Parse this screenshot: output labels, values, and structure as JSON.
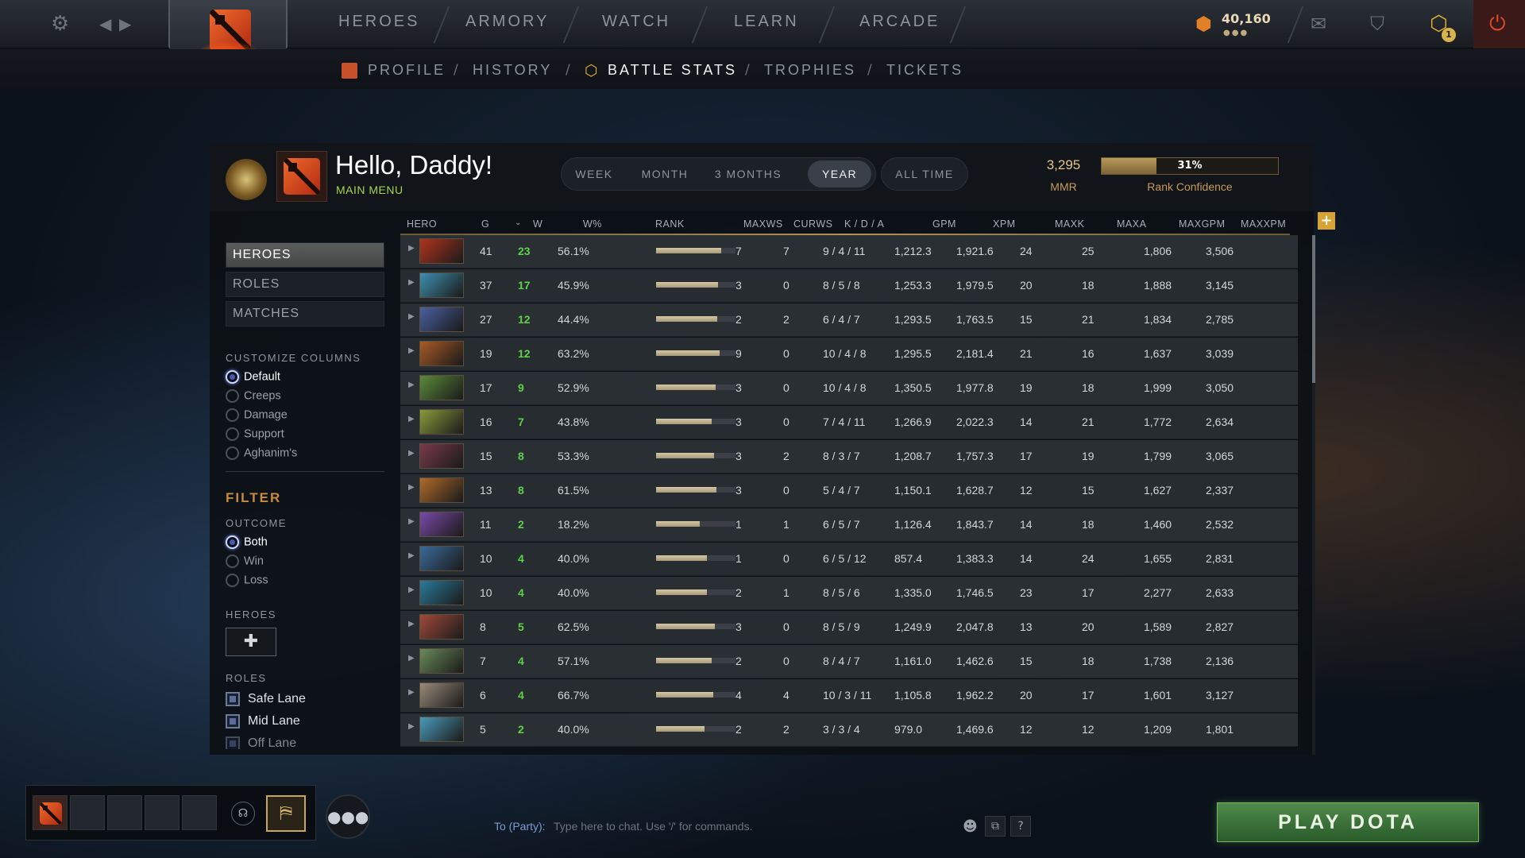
{
  "topnav": {
    "items": [
      "HEROES",
      "ARMORY",
      "WATCH",
      "LEARN",
      "ARCADE"
    ],
    "shards": "40,160",
    "notif_count": "1"
  },
  "subnav": {
    "items": [
      "PROFILE",
      "HISTORY",
      "BATTLE STATS",
      "TROPHIES",
      "TICKETS"
    ],
    "active": "BATTLE STATS"
  },
  "profile": {
    "greeting": "Hello, Daddy!",
    "main_menu": "MAIN MENU",
    "mmr": "3,295",
    "mmr_label": "MMR",
    "confidence_pct": "31%",
    "confidence_value": 0.31,
    "confidence_label": "Rank Confidence"
  },
  "ranges": [
    "WEEK",
    "MONTH",
    "3 MONTHS",
    "YEAR"
  ],
  "range_selected": "YEAR",
  "all_time": "ALL TIME",
  "columns": [
    "HERO",
    "G",
    "W",
    "W%",
    "RANK",
    "MAXWS",
    "CURWS",
    "K / D / A",
    "GPM",
    "XPM",
    "MAXK",
    "MAXA",
    "MAXGPM",
    "MAXXPM"
  ],
  "sidebar": {
    "tabs": [
      "HEROES",
      "ROLES",
      "MATCHES"
    ],
    "customize_title": "CUSTOMIZE COLUMNS",
    "customize_options": [
      "Default",
      "Creeps",
      "Damage",
      "Support",
      "Aghanim's"
    ],
    "filter_title": "FILTER",
    "outcome_title": "OUTCOME",
    "outcome_options": [
      "Both",
      "Win",
      "Loss"
    ],
    "heroes_title": "HEROES",
    "add_symbol": "✚",
    "roles_title": "ROLES",
    "roles": [
      "Safe Lane",
      "Mid Lane",
      "Off Lane"
    ]
  },
  "rows": [
    {
      "g": "41",
      "w": "23",
      "wp": "56.1%",
      "rank": 0.82,
      "maxws": "7",
      "curws": "7",
      "kda": "9 / 4 / 11",
      "gpm": "1,212.3",
      "xpm": "1,921.6",
      "maxk": "24",
      "maxa": "25",
      "maxgpm": "1,806",
      "maxxpm": "3,506",
      "color": "#b0341c"
    },
    {
      "g": "37",
      "w": "17",
      "wp": "45.9%",
      "rank": 0.78,
      "maxws": "3",
      "curws": "0",
      "kda": "8 / 5 / 8",
      "gpm": "1,253.3",
      "xpm": "1,979.5",
      "maxk": "20",
      "maxa": "18",
      "maxgpm": "1,888",
      "maxxpm": "3,145",
      "color": "#3f8fb0"
    },
    {
      "g": "27",
      "w": "12",
      "wp": "44.4%",
      "rank": 0.77,
      "maxws": "2",
      "curws": "2",
      "kda": "6 / 4 / 7",
      "gpm": "1,293.5",
      "xpm": "1,763.5",
      "maxk": "15",
      "maxa": "21",
      "maxgpm": "1,834",
      "maxxpm": "2,785",
      "color": "#4a5fa0"
    },
    {
      "g": "19",
      "w": "12",
      "wp": "63.2%",
      "rank": 0.8,
      "maxws": "9",
      "curws": "0",
      "kda": "10 / 4 / 8",
      "gpm": "1,295.5",
      "xpm": "2,181.4",
      "maxk": "21",
      "maxa": "16",
      "maxgpm": "1,637",
      "maxxpm": "3,039",
      "color": "#a85a26"
    },
    {
      "g": "17",
      "w": "9",
      "wp": "52.9%",
      "rank": 0.75,
      "maxws": "3",
      "curws": "0",
      "kda": "10 / 4 / 8",
      "gpm": "1,350.5",
      "xpm": "1,977.8",
      "maxk": "19",
      "maxa": "18",
      "maxgpm": "1,999",
      "maxxpm": "3,050",
      "color": "#5a8a3a"
    },
    {
      "g": "16",
      "w": "7",
      "wp": "43.8%",
      "rank": 0.7,
      "maxws": "3",
      "curws": "0",
      "kda": "7 / 4 / 11",
      "gpm": "1,266.9",
      "xpm": "2,022.3",
      "maxk": "14",
      "maxa": "21",
      "maxgpm": "1,772",
      "maxxpm": "2,634",
      "color": "#8a9a3a"
    },
    {
      "g": "15",
      "w": "8",
      "wp": "53.3%",
      "rank": 0.73,
      "maxws": "3",
      "curws": "2",
      "kda": "8 / 3 / 7",
      "gpm": "1,208.7",
      "xpm": "1,757.3",
      "maxk": "17",
      "maxa": "19",
      "maxgpm": "1,799",
      "maxxpm": "3,065",
      "color": "#7a3a4a"
    },
    {
      "g": "13",
      "w": "8",
      "wp": "61.5%",
      "rank": 0.76,
      "maxws": "3",
      "curws": "0",
      "kda": "5 / 4 / 7",
      "gpm": "1,150.1",
      "xpm": "1,628.7",
      "maxk": "12",
      "maxa": "15",
      "maxgpm": "1,627",
      "maxxpm": "2,337",
      "color": "#b06a2a"
    },
    {
      "g": "11",
      "w": "2",
      "wp": "18.2%",
      "rank": 0.55,
      "maxws": "1",
      "curws": "1",
      "kda": "6 / 5 / 7",
      "gpm": "1,126.4",
      "xpm": "1,843.7",
      "maxk": "14",
      "maxa": "18",
      "maxgpm": "1,460",
      "maxxpm": "2,532",
      "color": "#7a4aa8"
    },
    {
      "g": "10",
      "w": "4",
      "wp": "40.0%",
      "rank": 0.64,
      "maxws": "1",
      "curws": "0",
      "kda": "6 / 5 / 12",
      "gpm": "857.4",
      "xpm": "1,383.3",
      "maxk": "14",
      "maxa": "24",
      "maxgpm": "1,655",
      "maxxpm": "2,831",
      "color": "#3a6a9a"
    },
    {
      "g": "10",
      "w": "4",
      "wp": "40.0%",
      "rank": 0.64,
      "maxws": "2",
      "curws": "1",
      "kda": "8 / 5 / 6",
      "gpm": "1,335.0",
      "xpm": "1,746.5",
      "maxk": "23",
      "maxa": "17",
      "maxgpm": "2,277",
      "maxxpm": "2,633",
      "color": "#2a7a9a"
    },
    {
      "g": "8",
      "w": "5",
      "wp": "62.5%",
      "rank": 0.74,
      "maxws": "3",
      "curws": "0",
      "kda": "8 / 5 / 9",
      "gpm": "1,249.9",
      "xpm": "2,047.8",
      "maxk": "13",
      "maxa": "20",
      "maxgpm": "1,589",
      "maxxpm": "2,827",
      "color": "#a04a3a"
    },
    {
      "g": "7",
      "w": "4",
      "wp": "57.1%",
      "rank": 0.7,
      "maxws": "2",
      "curws": "0",
      "kda": "8 / 4 / 7",
      "gpm": "1,161.0",
      "xpm": "1,462.6",
      "maxk": "15",
      "maxa": "18",
      "maxgpm": "1,738",
      "maxxpm": "2,136",
      "color": "#6a8a5a"
    },
    {
      "g": "6",
      "w": "4",
      "wp": "66.7%",
      "rank": 0.72,
      "maxws": "4",
      "curws": "4",
      "kda": "10 / 3 / 11",
      "gpm": "1,105.8",
      "xpm": "1,962.2",
      "maxk": "20",
      "maxa": "17",
      "maxgpm": "1,601",
      "maxxpm": "3,127",
      "color": "#9a8a7a"
    },
    {
      "g": "5",
      "w": "2",
      "wp": "40.0%",
      "rank": 0.61,
      "maxws": "2",
      "curws": "2",
      "kda": "3 / 3 / 4",
      "gpm": "979.0",
      "xpm": "1,469.6",
      "maxk": "12",
      "maxa": "12",
      "maxgpm": "1,209",
      "maxxpm": "1,801",
      "color": "#4a9aba"
    }
  ],
  "chat": {
    "to": "To (Party):",
    "placeholder": "Type here to chat. Use '/' for commands."
  },
  "play_button": "PLAY DOTA"
}
